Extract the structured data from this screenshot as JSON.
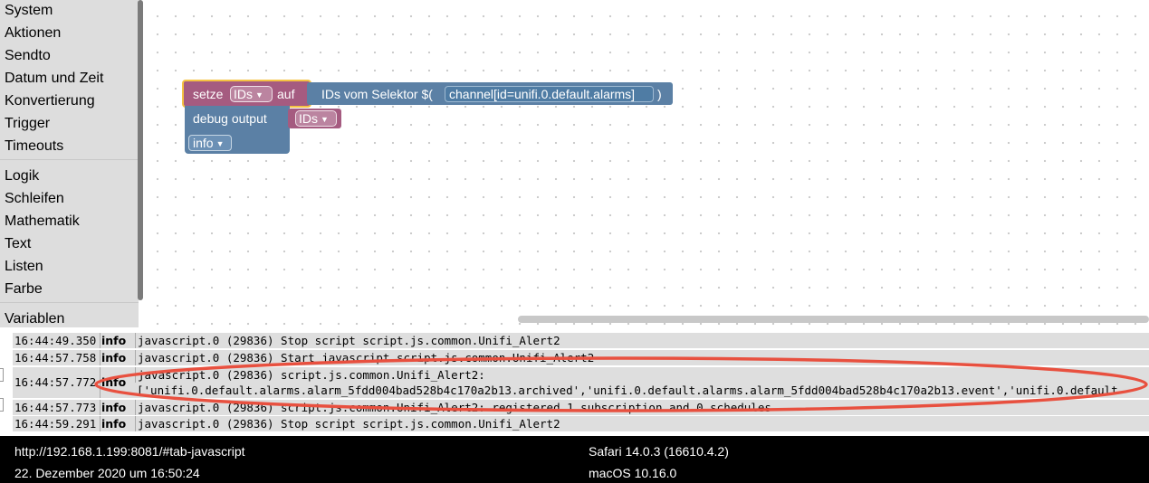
{
  "toolbox": {
    "categories": [
      "System",
      "Aktionen",
      "Sendto",
      "Datum und Zeit",
      "Konvertierung",
      "Trigger",
      "Timeouts",
      "Logik",
      "Schleifen",
      "Mathematik",
      "Text",
      "Listen",
      "Farbe",
      "Variablen"
    ]
  },
  "blocks": {
    "set_keyword": "setze",
    "set_var": "IDs",
    "set_to": "auf",
    "selector_label": "IDs vom Selektor $(",
    "selector_value": "channel[id=unifi.0.default.alarms]",
    "selector_close": ")",
    "debug_label": "debug output",
    "debug_var": "IDs",
    "debug_level": "info"
  },
  "log": [
    {
      "time": "16:44:49.350",
      "level": "info",
      "message": "javascript.0 (29836) Stop script script.js.common.Unifi_Alert2"
    },
    {
      "time": "16:44:57.758",
      "level": "info",
      "message": "javascript.0 (29836) Start javascript script.js.common.Unifi_Alert2"
    },
    {
      "time": "16:44:57.772",
      "level": "info",
      "message": "javascript.0 (29836) script.js.common.Unifi_Alert2:",
      "message2": "['unifi.0.default.alarms.alarm_5fdd004bad528b4c170a2b13.archived','unifi.0.default.alarms.alarm_5fdd004bad528b4c170a2b13.event','unifi.0.default"
    },
    {
      "time": "16:44:57.773",
      "level": "info",
      "message": "javascript.0 (29836) script.js.common.Unifi_Alert2: registered 1 subscription and 0 schedules"
    },
    {
      "time": "16:44:59.291",
      "level": "info",
      "message": "javascript.0 (29836) Stop script script.js.common.Unifi_Alert2"
    }
  ],
  "statusbar": {
    "url": "http://192.168.1.199:8081/#tab-javascript",
    "date": "22. Dezember 2020 um 16:50:24",
    "browser": "Safari 14.0.3 (16610.4.2)",
    "os": "macOS 10.16.0"
  },
  "colors": {
    "variable_block": "#a55b80",
    "action_block": "#5b80a5",
    "highlight": "#f5c242",
    "annotation": "#e8503f"
  }
}
